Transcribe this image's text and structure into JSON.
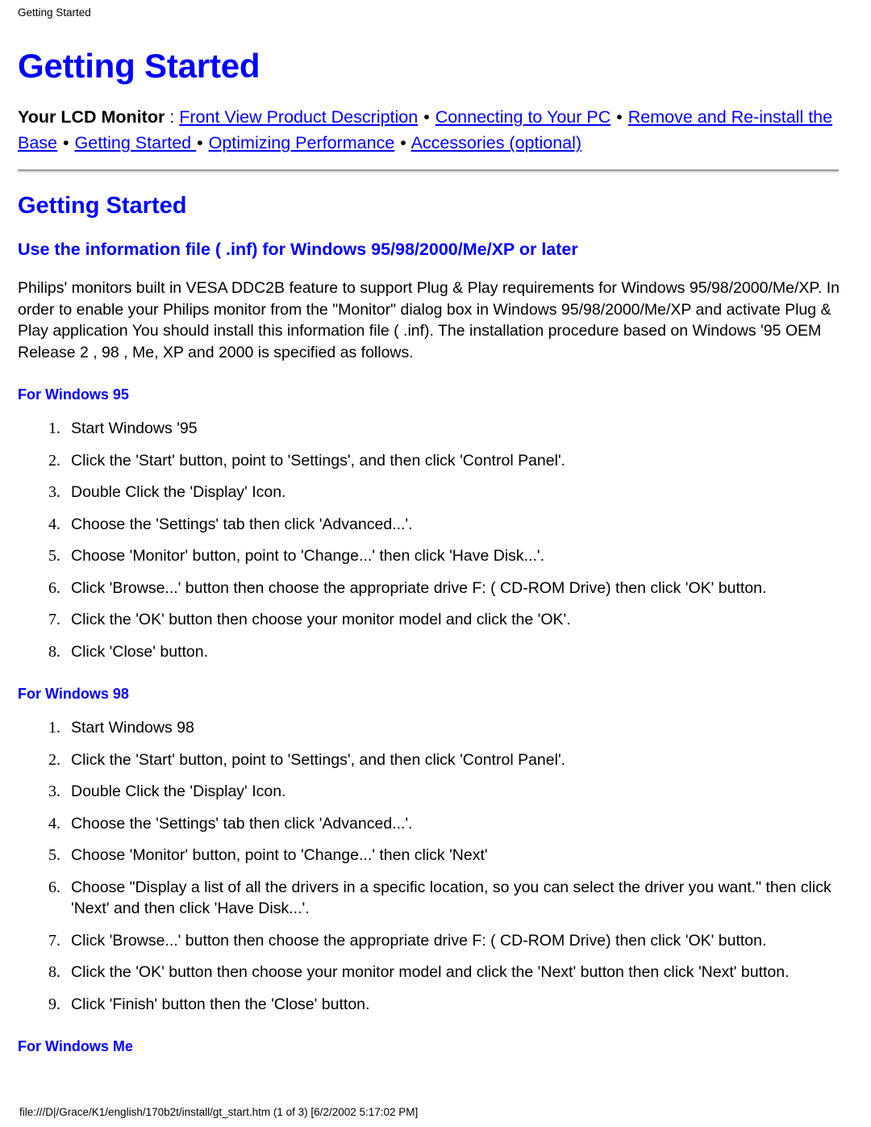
{
  "colors": {
    "link_blue": "#0000ff",
    "text_black": "#000000",
    "page_background": "#ffffff",
    "rule_gray": "#9a9a9a"
  },
  "running_header": "Getting Started",
  "doc_title": "Getting Started",
  "navline": {
    "prefix": "Your LCD Monitor",
    "colon": " : ",
    "separator": "•",
    "links": [
      "Front View Product Description",
      "Connecting to Your PC",
      "Remove and Re-install the Base",
      "Getting Started ",
      "Optimizing Performance",
      "Accessories (optional)"
    ]
  },
  "section": {
    "title": "Getting Started",
    "subtitle": "Use the information file ( .inf) for Windows 95/98/2000/Me/XP or later",
    "intro_paragraph": "Philips' monitors built in VESA DDC2B feature to support Plug & Play requirements for Windows 95/98/2000/Me/XP. In order to enable your Philips monitor from the \"Monitor\" dialog box in Windows 95/98/2000/Me/XP and activate Plug & Play application You should install this information file ( .inf). The installation procedure based on Windows '95 OEM Release 2 , 98 , Me, XP and 2000 is specified as follows."
  },
  "os_sections": [
    {
      "heading": "For Windows 95",
      "steps": [
        "Start Windows '95",
        "Click the 'Start' button, point to 'Settings', and then click 'Control Panel'.",
        "Double Click the 'Display' Icon.",
        "Choose the 'Settings' tab then click 'Advanced...'.",
        "Choose 'Monitor' button, point to 'Change...' then click 'Have Disk...'.",
        "Click 'Browse...' button then choose the appropriate drive F: ( CD-ROM Drive) then click 'OK' button.",
        "Click the 'OK' button then choose your monitor model and click the 'OK'.",
        "Click 'Close' button."
      ]
    },
    {
      "heading": "For Windows 98",
      "steps": [
        "Start Windows 98",
        "Click the 'Start' button, point to 'Settings', and then click 'Control Panel'.",
        "Double Click the 'Display' Icon.",
        "Choose the 'Settings' tab then click 'Advanced...'.",
        "Choose 'Monitor' button, point to 'Change...' then click 'Next'",
        "Choose \"Display a list of all the drivers in a specific location, so you can select the driver you want.\" then click 'Next' and then click 'Have Disk...'.",
        "Click 'Browse...' button then choose the appropriate drive F: ( CD-ROM Drive) then click 'OK' button.",
        "Click the 'OK' button then choose your monitor model and click the 'Next' button then click 'Next' button.",
        "Click 'Finish' button then the 'Close' button."
      ]
    },
    {
      "heading": "For Windows Me",
      "steps": []
    }
  ],
  "footer": "file:///D|/Grace/K1/english/170b2t/install/gt_start.htm (1 of 3) [6/2/2002 5:17:02 PM]"
}
